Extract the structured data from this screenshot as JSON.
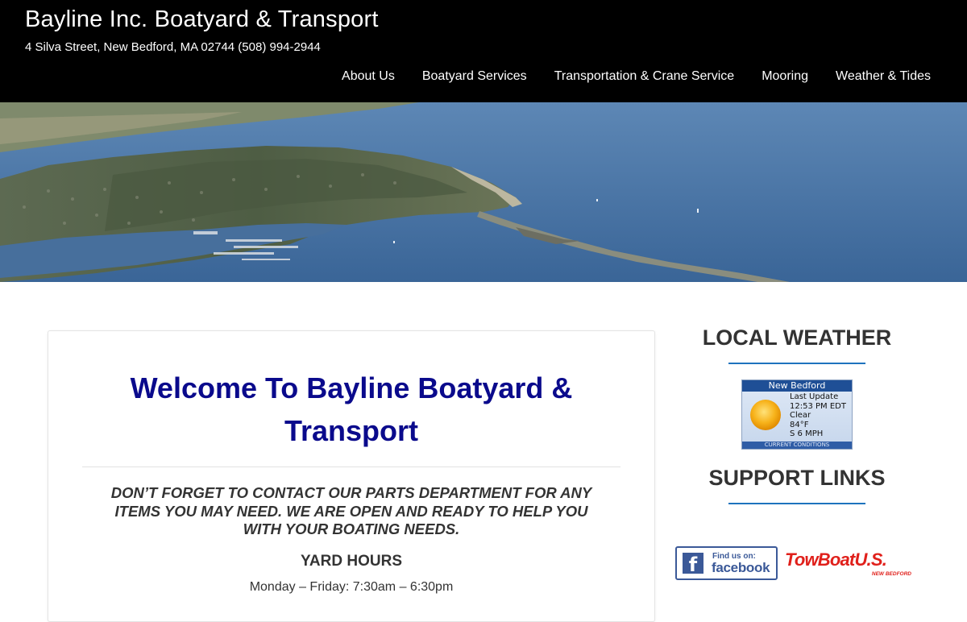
{
  "site": {
    "title": "Bayline Inc. Boatyard & Transport",
    "tagline": "4 Silva Street, New Bedford, MA 02744 (508) 994-2944"
  },
  "nav": {
    "items": [
      {
        "label": "About Us"
      },
      {
        "label": "Boatyard Services"
      },
      {
        "label": "Transportation & Crane Service"
      },
      {
        "label": "Mooring"
      },
      {
        "label": "Weather & Tides"
      }
    ]
  },
  "main": {
    "title_line1": "Welcome To Bayline Boatyard &",
    "title_line2": "Transport",
    "notice_line1": "DON’T FORGET TO CONTACT OUR PARTS DEPARTMENT FOR ANY",
    "notice_line2": "ITEMS YOU MAY NEED. WE ARE OPEN AND READY TO HELP YOU",
    "notice_line3": "WITH YOUR BOATING NEEDS.",
    "hours_title": "YARD HOURS",
    "hours_line": "Monday – Friday: 7:30am – 6:30pm"
  },
  "sidebar": {
    "weather_title": "LOCAL WEATHER",
    "weather_widget": {
      "location": "New Bedford",
      "update_label": "Last Update",
      "time": "12:53 PM EDT",
      "condition": "Clear",
      "temperature": "84°F",
      "wind": "S 6 MPH",
      "footer": "CURRENT CONDITIONS",
      "icon": "sun-icon"
    },
    "support_title": "SUPPORT LINKS",
    "facebook": {
      "small": "Find us on:",
      "big": "facebook",
      "icon": "facebook-f-icon"
    },
    "towboat": {
      "logo": "TowBoatU.S.",
      "sub": "NEW BEDFORD"
    }
  },
  "colors": {
    "header_bg": "#000000",
    "title_blue": "#0a0a8c",
    "accent_rule": "#1e73be",
    "facebook_blue": "#3b5998",
    "towboat_red": "#e0201b"
  }
}
